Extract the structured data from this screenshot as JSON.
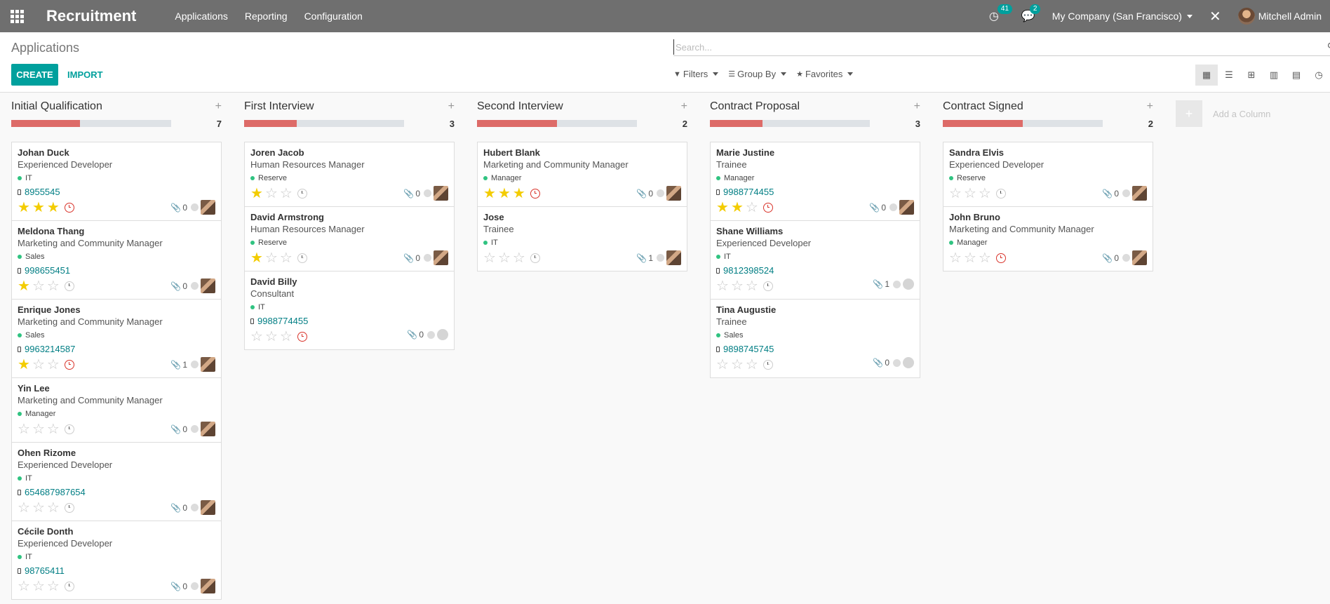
{
  "navbar": {
    "brand": "Recruitment",
    "menus": [
      "Applications",
      "Reporting",
      "Configuration"
    ],
    "activity_count": "41",
    "message_count": "2",
    "company": "My Company (San Francisco)",
    "user": "Mitchell Admin"
  },
  "control": {
    "breadcrumb": "Applications",
    "create_label": "CREATE",
    "import_label": "IMPORT",
    "search_placeholder": "Search...",
    "filters_label": "Filters",
    "groupby_label": "Group By",
    "favorites_label": "Favorites"
  },
  "add_column_label": "Add a Column",
  "columns": [
    {
      "title": "Initial Qualification",
      "count": "7",
      "progress": 0.43,
      "cards": [
        {
          "name": "Johan Duck",
          "job": "Experienced Developer",
          "tag": "IT",
          "phone": "8955545",
          "stars": 3,
          "late": true,
          "attachments": "0",
          "avatar": true
        },
        {
          "name": "Meldona Thang",
          "job": "Marketing and Community Manager",
          "tag": "Sales",
          "phone": "998655451",
          "stars": 1,
          "late": false,
          "attachments": "0",
          "avatar": true
        },
        {
          "name": "Enrique Jones",
          "job": "Marketing and Community Manager",
          "tag": "Sales",
          "phone": "9963214587",
          "stars": 1,
          "late": true,
          "attachments": "1",
          "avatar": true
        },
        {
          "name": "Yin Lee",
          "job": "Marketing and Community Manager",
          "tag": "Manager",
          "phone": "",
          "stars": 0,
          "late": false,
          "attachments": "0",
          "avatar": true
        },
        {
          "name": "Ohen Rizome",
          "job": "Experienced Developer",
          "tag": "IT",
          "phone": "654687987654",
          "stars": 0,
          "late": false,
          "attachments": "0",
          "avatar": true
        },
        {
          "name": "Cécile Donth",
          "job": "Experienced Developer",
          "tag": "IT",
          "phone": "98765411",
          "stars": 0,
          "late": false,
          "attachments": "0",
          "avatar": true
        }
      ]
    },
    {
      "title": "First Interview",
      "count": "3",
      "progress": 0.33,
      "cards": [
        {
          "name": "Joren Jacob",
          "job": "Human Resources Manager",
          "tag": "Reserve",
          "phone": "",
          "stars": 1,
          "late": false,
          "attachments": "0",
          "avatar": true
        },
        {
          "name": "David Armstrong",
          "job": "Human Resources Manager",
          "tag": "Reserve",
          "phone": "",
          "stars": 1,
          "late": false,
          "attachments": "0",
          "avatar": true
        },
        {
          "name": "David Billy",
          "job": "Consultant",
          "tag": "IT",
          "phone": "9988774455",
          "stars": 0,
          "late": true,
          "attachments": "0",
          "avatar": false
        }
      ]
    },
    {
      "title": "Second Interview",
      "count": "2",
      "progress": 0.5,
      "cards": [
        {
          "name": "Hubert Blank",
          "job": "Marketing and Community Manager",
          "tag": "Manager",
          "phone": "",
          "stars": 3,
          "late": true,
          "attachments": "0",
          "avatar": true
        },
        {
          "name": "Jose",
          "job": "Trainee",
          "tag": "IT",
          "phone": "",
          "stars": 0,
          "late": false,
          "attachments": "1",
          "avatar": true
        }
      ]
    },
    {
      "title": "Contract Proposal",
      "count": "3",
      "progress": 0.33,
      "cards": [
        {
          "name": "Marie Justine",
          "job": "Trainee",
          "tag": "Manager",
          "phone": "9988774455",
          "stars": 2,
          "late": true,
          "attachments": "0",
          "avatar": true
        },
        {
          "name": "Shane Williams",
          "job": "Experienced Developer",
          "tag": "IT",
          "phone": "9812398524",
          "stars": 0,
          "late": false,
          "attachments": "1",
          "avatar": false
        },
        {
          "name": "Tina Augustie",
          "job": "Trainee",
          "tag": "Sales",
          "phone": "9898745745",
          "stars": 0,
          "late": false,
          "attachments": "0",
          "avatar": false
        }
      ]
    },
    {
      "title": "Contract Signed",
      "count": "2",
      "progress": 0.5,
      "cards": [
        {
          "name": "Sandra Elvis",
          "job": "Experienced Developer",
          "tag": "Reserve",
          "phone": "",
          "stars": 0,
          "late": false,
          "attachments": "0",
          "avatar": true
        },
        {
          "name": "John Bruno",
          "job": "Marketing and Community Manager",
          "tag": "Manager",
          "phone": "",
          "stars": 0,
          "late": true,
          "attachments": "0",
          "avatar": true
        }
      ]
    }
  ]
}
